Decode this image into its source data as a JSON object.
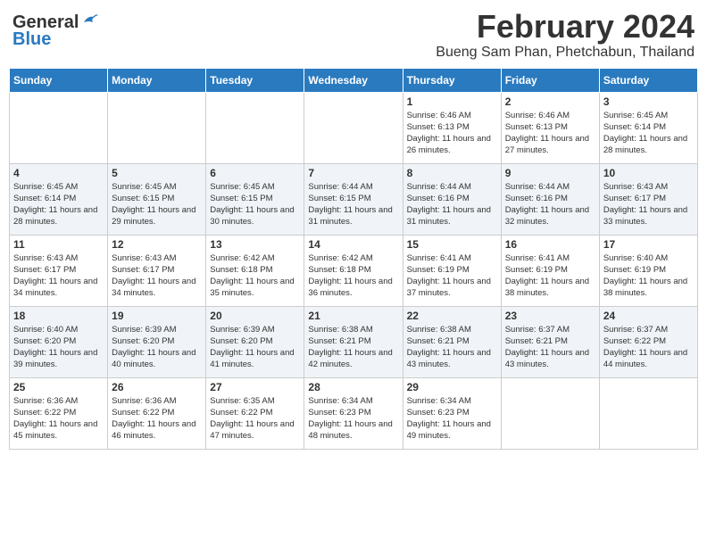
{
  "header": {
    "logo_general": "General",
    "logo_blue": "Blue",
    "month_title": "February 2024",
    "location": "Bueng Sam Phan, Phetchabun, Thailand"
  },
  "weekdays": [
    "Sunday",
    "Monday",
    "Tuesday",
    "Wednesday",
    "Thursday",
    "Friday",
    "Saturday"
  ],
  "weeks": [
    [
      {
        "day": "",
        "info": ""
      },
      {
        "day": "",
        "info": ""
      },
      {
        "day": "",
        "info": ""
      },
      {
        "day": "",
        "info": ""
      },
      {
        "day": "1",
        "info": "Sunrise: 6:46 AM\nSunset: 6:13 PM\nDaylight: 11 hours and 26 minutes."
      },
      {
        "day": "2",
        "info": "Sunrise: 6:46 AM\nSunset: 6:13 PM\nDaylight: 11 hours and 27 minutes."
      },
      {
        "day": "3",
        "info": "Sunrise: 6:45 AM\nSunset: 6:14 PM\nDaylight: 11 hours and 28 minutes."
      }
    ],
    [
      {
        "day": "4",
        "info": "Sunrise: 6:45 AM\nSunset: 6:14 PM\nDaylight: 11 hours and 28 minutes."
      },
      {
        "day": "5",
        "info": "Sunrise: 6:45 AM\nSunset: 6:15 PM\nDaylight: 11 hours and 29 minutes."
      },
      {
        "day": "6",
        "info": "Sunrise: 6:45 AM\nSunset: 6:15 PM\nDaylight: 11 hours and 30 minutes."
      },
      {
        "day": "7",
        "info": "Sunrise: 6:44 AM\nSunset: 6:15 PM\nDaylight: 11 hours and 31 minutes."
      },
      {
        "day": "8",
        "info": "Sunrise: 6:44 AM\nSunset: 6:16 PM\nDaylight: 11 hours and 31 minutes."
      },
      {
        "day": "9",
        "info": "Sunrise: 6:44 AM\nSunset: 6:16 PM\nDaylight: 11 hours and 32 minutes."
      },
      {
        "day": "10",
        "info": "Sunrise: 6:43 AM\nSunset: 6:17 PM\nDaylight: 11 hours and 33 minutes."
      }
    ],
    [
      {
        "day": "11",
        "info": "Sunrise: 6:43 AM\nSunset: 6:17 PM\nDaylight: 11 hours and 34 minutes."
      },
      {
        "day": "12",
        "info": "Sunrise: 6:43 AM\nSunset: 6:17 PM\nDaylight: 11 hours and 34 minutes."
      },
      {
        "day": "13",
        "info": "Sunrise: 6:42 AM\nSunset: 6:18 PM\nDaylight: 11 hours and 35 minutes."
      },
      {
        "day": "14",
        "info": "Sunrise: 6:42 AM\nSunset: 6:18 PM\nDaylight: 11 hours and 36 minutes."
      },
      {
        "day": "15",
        "info": "Sunrise: 6:41 AM\nSunset: 6:19 PM\nDaylight: 11 hours and 37 minutes."
      },
      {
        "day": "16",
        "info": "Sunrise: 6:41 AM\nSunset: 6:19 PM\nDaylight: 11 hours and 38 minutes."
      },
      {
        "day": "17",
        "info": "Sunrise: 6:40 AM\nSunset: 6:19 PM\nDaylight: 11 hours and 38 minutes."
      }
    ],
    [
      {
        "day": "18",
        "info": "Sunrise: 6:40 AM\nSunset: 6:20 PM\nDaylight: 11 hours and 39 minutes."
      },
      {
        "day": "19",
        "info": "Sunrise: 6:39 AM\nSunset: 6:20 PM\nDaylight: 11 hours and 40 minutes."
      },
      {
        "day": "20",
        "info": "Sunrise: 6:39 AM\nSunset: 6:20 PM\nDaylight: 11 hours and 41 minutes."
      },
      {
        "day": "21",
        "info": "Sunrise: 6:38 AM\nSunset: 6:21 PM\nDaylight: 11 hours and 42 minutes."
      },
      {
        "day": "22",
        "info": "Sunrise: 6:38 AM\nSunset: 6:21 PM\nDaylight: 11 hours and 43 minutes."
      },
      {
        "day": "23",
        "info": "Sunrise: 6:37 AM\nSunset: 6:21 PM\nDaylight: 11 hours and 43 minutes."
      },
      {
        "day": "24",
        "info": "Sunrise: 6:37 AM\nSunset: 6:22 PM\nDaylight: 11 hours and 44 minutes."
      }
    ],
    [
      {
        "day": "25",
        "info": "Sunrise: 6:36 AM\nSunset: 6:22 PM\nDaylight: 11 hours and 45 minutes."
      },
      {
        "day": "26",
        "info": "Sunrise: 6:36 AM\nSunset: 6:22 PM\nDaylight: 11 hours and 46 minutes."
      },
      {
        "day": "27",
        "info": "Sunrise: 6:35 AM\nSunset: 6:22 PM\nDaylight: 11 hours and 47 minutes."
      },
      {
        "day": "28",
        "info": "Sunrise: 6:34 AM\nSunset: 6:23 PM\nDaylight: 11 hours and 48 minutes."
      },
      {
        "day": "29",
        "info": "Sunrise: 6:34 AM\nSunset: 6:23 PM\nDaylight: 11 hours and 49 minutes."
      },
      {
        "day": "",
        "info": ""
      },
      {
        "day": "",
        "info": ""
      }
    ]
  ]
}
